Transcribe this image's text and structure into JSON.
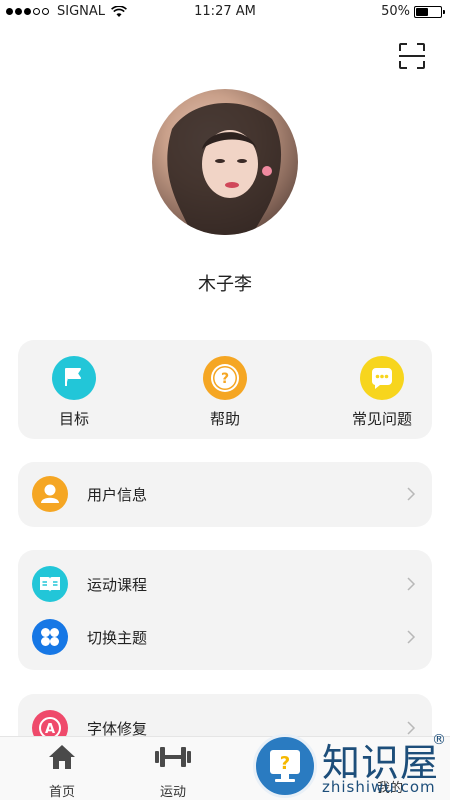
{
  "status_bar": {
    "carrier": "SIGNAL",
    "time": "11:27 AM",
    "battery_percent": "50%",
    "battery_level": 0.5
  },
  "profile": {
    "username": "木子李"
  },
  "quick_actions": [
    {
      "label": "目标",
      "icon": "flag-icon",
      "color": "#22c6d8"
    },
    {
      "label": "帮助",
      "icon": "question-icon",
      "color": "#f5a623"
    },
    {
      "label": "常见问题",
      "icon": "chat-icon",
      "color": "#f7d51d"
    }
  ],
  "menu_groups": [
    [
      {
        "label": "用户信息",
        "icon": "user-icon",
        "color": "#f5a623"
      }
    ],
    [
      {
        "label": "运动课程",
        "icon": "book-icon",
        "color": "#22c6d8"
      },
      {
        "label": "切换主题",
        "icon": "theme-icon",
        "color": "#1677e5"
      }
    ],
    [
      {
        "label": "字体修复",
        "icon": "font-icon",
        "color": "#ef4a6b"
      }
    ]
  ],
  "tab_bar": [
    {
      "label": "首页",
      "icon": "home-icon"
    },
    {
      "label": "运动",
      "icon": "dumbbell-icon"
    },
    {
      "label": "我的",
      "icon": "profile-icon"
    }
  ],
  "watermark": {
    "title": "知识屋",
    "subtitle": "zhishiwu.com",
    "registered": "®"
  }
}
